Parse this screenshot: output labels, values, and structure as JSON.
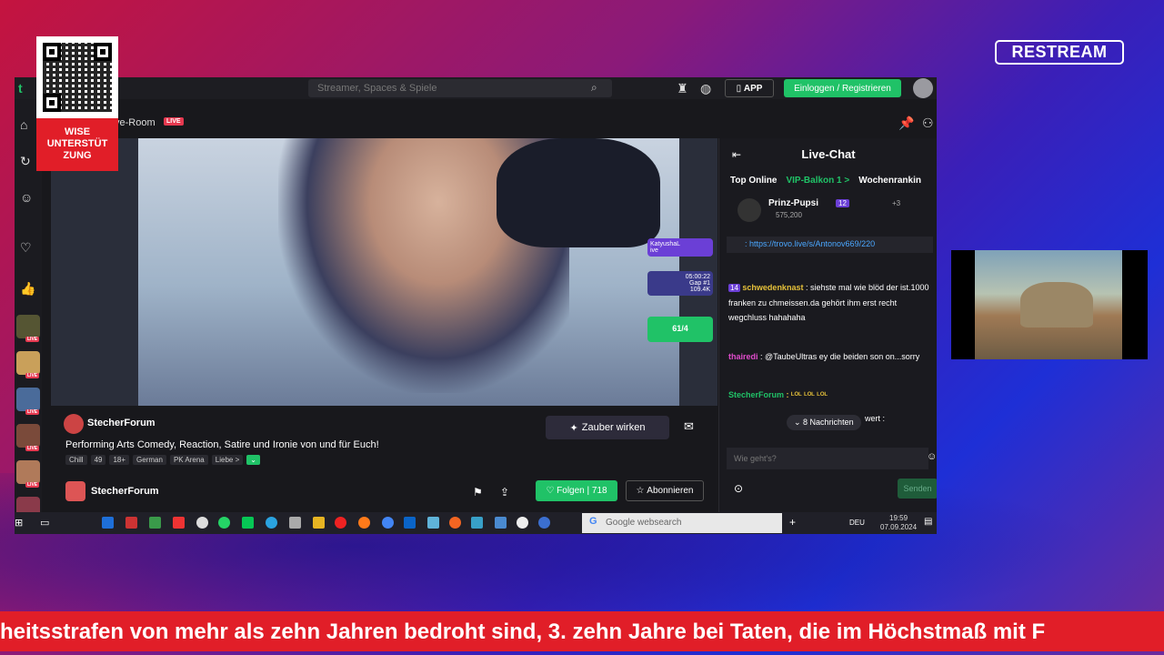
{
  "brand": {
    "restream": "RESTREAM"
  },
  "qr": {
    "label": "WISE UNTERSTÜT ZUNG"
  },
  "browser": {
    "search_placeholder": "Streamer, Spaces & Spiele",
    "app_label": "APP",
    "login_label": "Einloggen / Registrieren"
  },
  "room": {
    "title": "ve-Room",
    "live": "LIVE"
  },
  "overlay": {
    "card1_name": "KatyushaL",
    "card1_sub": "ive",
    "card2_time": "05:00:22",
    "card2_gap": "Gap #1",
    "card2_val": "109.4K",
    "card3_val": "61/4"
  },
  "stream": {
    "streamer": "StecherForum",
    "description": "Performing Arts Comedy, Reaction, Satire und Ironie von und für Euch!",
    "tags": [
      "Chill",
      "49",
      "18+",
      "German",
      "PK Arena",
      "Liebe >"
    ],
    "zauber": "Zauber wirken",
    "owner": "StecherForum",
    "follow": "Folgen",
    "follow_count": "718",
    "subscribe": "Abonnieren"
  },
  "chat": {
    "title": "Live-Chat",
    "tabs": [
      "Top Online",
      "VIP-Balkon 1 >",
      "Wochenrankin"
    ],
    "top_user": "Prinz-Pupsi",
    "top_badge": "12",
    "top_plus": "+3",
    "top_points": "575,200",
    "pinned_link": ": https://trovo.live/s/Antonov669/220",
    "messages": [
      {
        "badge": "14",
        "user": "schwedenknast",
        "text": ": siehste mal wie blöd der ist.1000 franken zu chmeissen.da gehört ihm erst recht wegchluss hahahaha"
      },
      {
        "user": "thairedi",
        "text": ": @TaubeUltras ey die beiden son on...sorry"
      },
      {
        "user": "StecherForum",
        "text": ": ᴸᴼᴸ ᴸᴼᴸ ᴸᴼᴸ"
      },
      {
        "user": "",
        "text": "wert :"
      }
    ],
    "new_messages": "8 Nachrichten",
    "input_placeholder": "Wie geht's?",
    "send": "Senden"
  },
  "taskbar": {
    "search": "Google websearch",
    "lang": "DEU",
    "time": "19:59",
    "date": "07.09.2024"
  },
  "ticker": {
    "text": "heitsstrafen von mehr als zehn Jahren bedroht sind, 3. zehn Jahre bei Taten, die im Höchstmaß mit F"
  },
  "colors": {
    "accent_green": "#20c267",
    "ticker_red": "#e11e28",
    "live_red": "#e63950"
  }
}
